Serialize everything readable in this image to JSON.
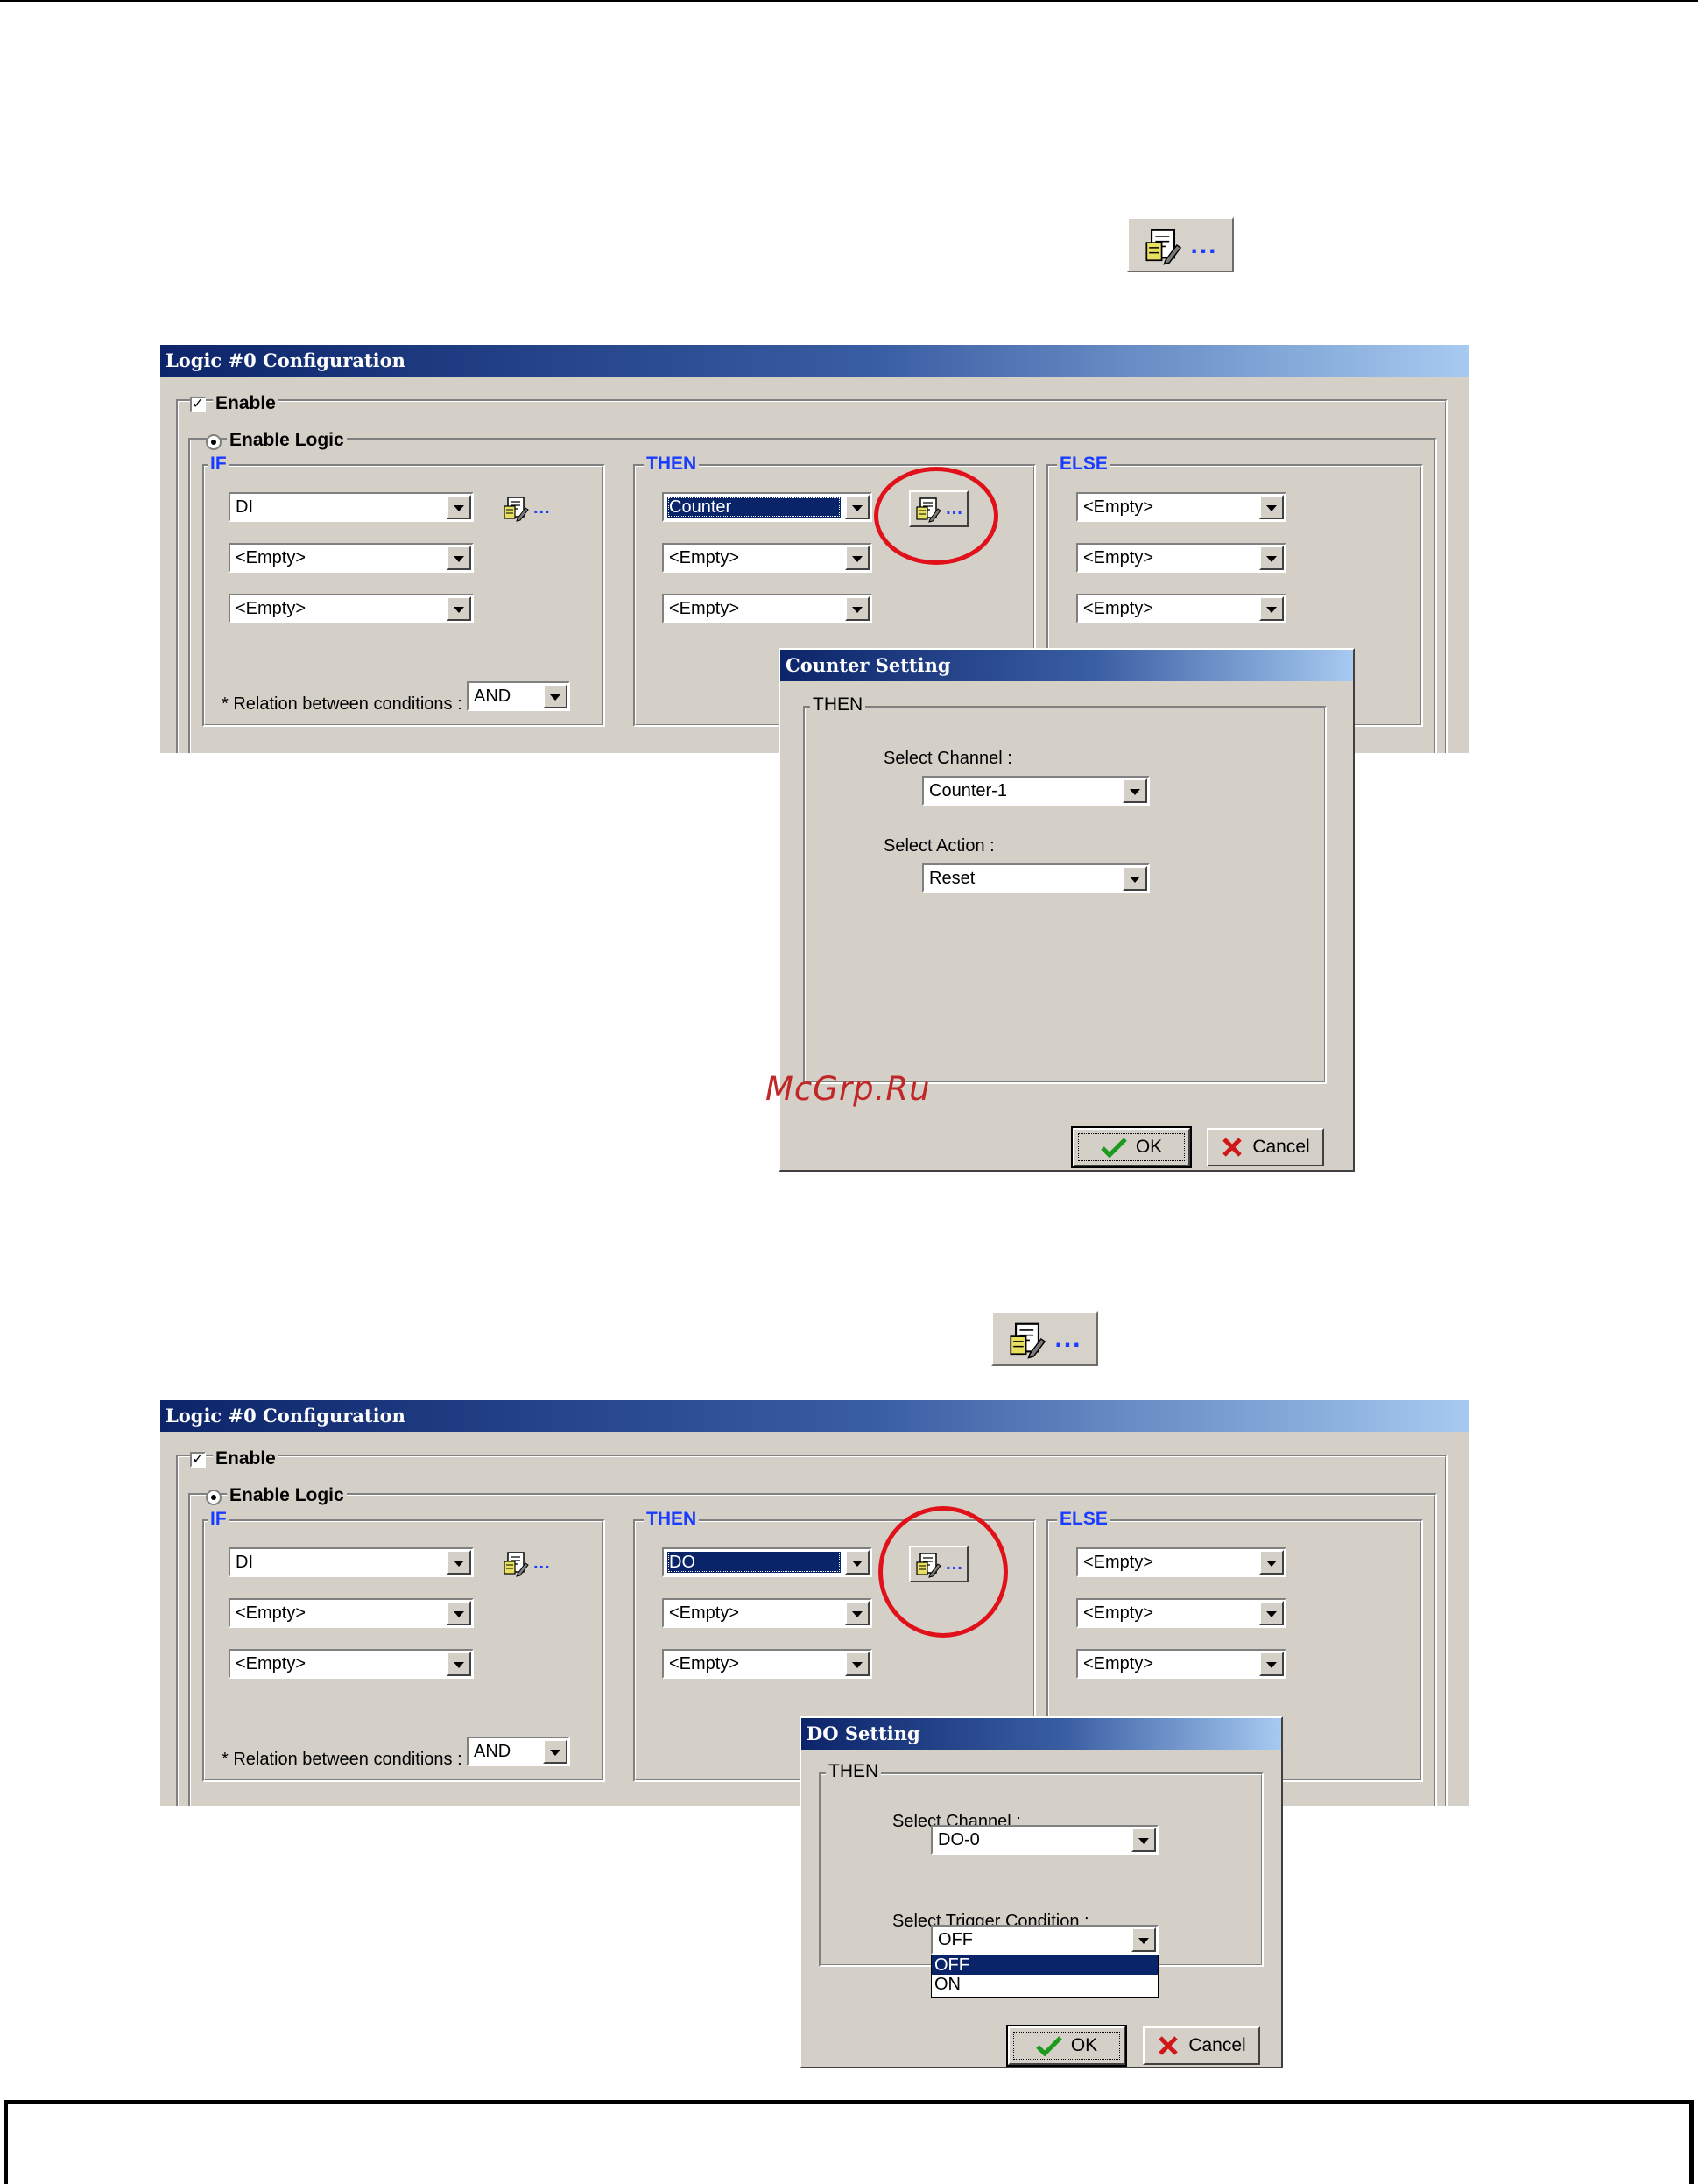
{
  "icons": {
    "settings_button": "document-edit-icon",
    "ok": "green-check-icon",
    "cancel": "red-x-icon",
    "dots": "..."
  },
  "colors": {
    "title_start": "#0c246a",
    "title_end": "#a6caf0",
    "face": "#d4d0c8",
    "blue_legend": "#1a3cff",
    "highlight": "#0a246a",
    "circle": "#e1111a"
  },
  "watermark": "McGrp.Ru",
  "dialog1": {
    "title": "Logic #0 Configuration",
    "enable": "Enable",
    "enable_logic": "Enable Logic",
    "if_label": "IF",
    "then_label": "THEN",
    "else_label": "ELSE",
    "if_values": [
      "DI",
      "<Empty>",
      "<Empty>"
    ],
    "then_values": [
      "Counter",
      "<Empty>",
      "<Empty>"
    ],
    "else_values": [
      "<Empty>",
      "<Empty>",
      "<Empty>"
    ],
    "relation_label": "* Relation between conditions :",
    "relation_value": "AND"
  },
  "counter_setting": {
    "title": "Counter Setting",
    "group": "THEN",
    "channel_label": "Select Channel :",
    "channel_value": "Counter-1",
    "action_label": "Select Action :",
    "action_value": "Reset",
    "ok": "OK",
    "cancel": "Cancel"
  },
  "dialog2": {
    "title": "Logic #0 Configuration",
    "enable": "Enable",
    "enable_logic": "Enable Logic",
    "if_label": "IF",
    "then_label": "THEN",
    "else_label": "ELSE",
    "if_values": [
      "DI",
      "<Empty>",
      "<Empty>"
    ],
    "then_values": [
      "DO",
      "<Empty>",
      "<Empty>"
    ],
    "else_values": [
      "<Empty>",
      "<Empty>",
      "<Empty>"
    ],
    "relation_label": "* Relation between conditions :",
    "relation_value": "AND"
  },
  "do_setting": {
    "title": "DO Setting",
    "group": "THEN",
    "channel_label": "Select Channel :",
    "channel_value": "DO-0",
    "trigger_label": "Select Trigger Condition :",
    "trigger_value": "OFF",
    "trigger_options": [
      "OFF",
      "ON"
    ],
    "ok": "OK",
    "cancel": "Cancel"
  }
}
